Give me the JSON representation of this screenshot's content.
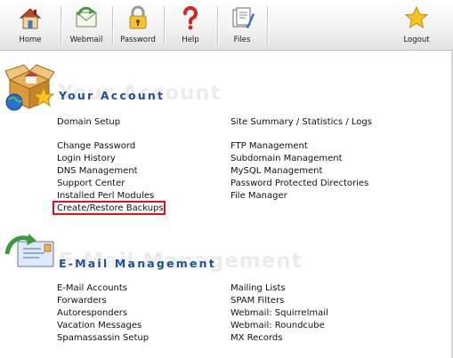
{
  "toolbar": {
    "home": {
      "label": "Home",
      "icon": "home-icon"
    },
    "webmail": {
      "label": "Webmail",
      "icon": "webmail-icon"
    },
    "password": {
      "label": "Password",
      "icon": "lock-icon"
    },
    "help": {
      "label": "Help",
      "icon": "question-icon"
    },
    "files": {
      "label": "Files",
      "icon": "files-icon"
    },
    "logout": {
      "label": "Logout",
      "icon": "star-icon"
    }
  },
  "your_account": {
    "heading": "Your Account",
    "icon": "account-box-icon",
    "links_left": [
      "Domain Setup",
      "Change Password",
      "Login History",
      "DNS Management",
      "Support Center",
      "Installed Perl Modules",
      "Create/Restore Backups"
    ],
    "links_right": [
      "Site Summary / Statistics / Logs",
      "FTP Management",
      "Subdomain Management",
      "MySQL Management",
      "Password Protected Directories",
      "File Manager"
    ],
    "highlighted": "Create/Restore Backups"
  },
  "email": {
    "heading": "E-Mail Management",
    "icon": "email-icon",
    "links_left": [
      "E-Mail Accounts",
      "Forwarders",
      "Autoresponders",
      "Vacation Messages",
      "Spamassassin Setup"
    ],
    "links_right": [
      "Mailing Lists",
      "SPAM Filters",
      "Webmail: Squirrelmail",
      "Webmail: Roundcube",
      "MX Records"
    ]
  },
  "colors": {
    "heading": "#1f4fa3",
    "highlight_border": "#e0121b",
    "link_text": "#111111"
  }
}
